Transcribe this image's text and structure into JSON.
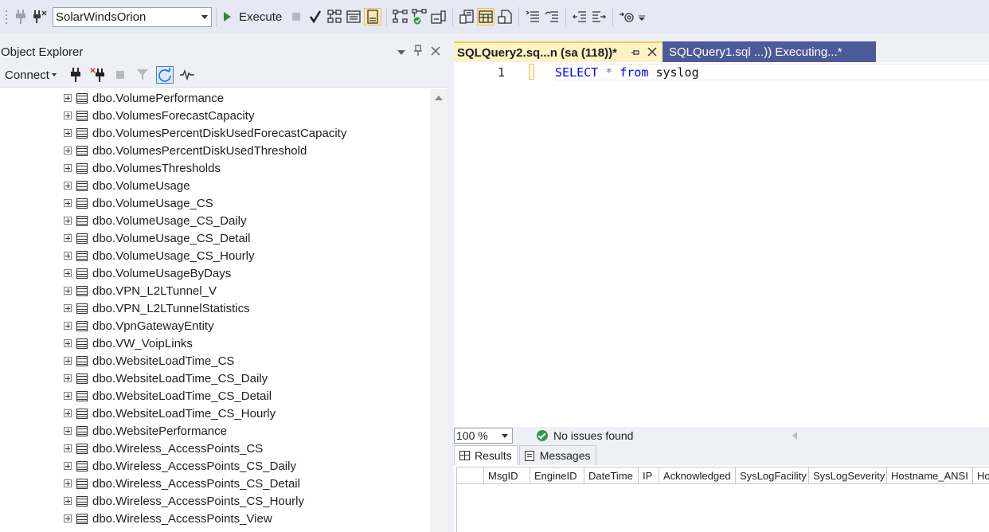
{
  "toolbar": {
    "database": "SolarWindsOrion",
    "execute_label": "Execute"
  },
  "object_explorer": {
    "title": "Object Explorer",
    "connect_label": "Connect",
    "items": [
      "dbo.VolumePerformance",
      "dbo.VolumesForecastCapacity",
      "dbo.VolumesPercentDiskUsedForecastCapacity",
      "dbo.VolumesPercentDiskUsedThreshold",
      "dbo.VolumesThresholds",
      "dbo.VolumeUsage",
      "dbo.VolumeUsage_CS",
      "dbo.VolumeUsage_CS_Daily",
      "dbo.VolumeUsage_CS_Detail",
      "dbo.VolumeUsage_CS_Hourly",
      "dbo.VolumeUsageByDays",
      "dbo.VPN_L2LTunnel_V",
      "dbo.VPN_L2LTunnelStatistics",
      "dbo.VpnGatewayEntity",
      "dbo.VW_VoipLinks",
      "dbo.WebsiteLoadTime_CS",
      "dbo.WebsiteLoadTime_CS_Daily",
      "dbo.WebsiteLoadTime_CS_Detail",
      "dbo.WebsiteLoadTime_CS_Hourly",
      "dbo.WebsitePerformance",
      "dbo.Wireless_AccessPoints_CS",
      "dbo.Wireless_AccessPoints_CS_Daily",
      "dbo.Wireless_AccessPoints_CS_Detail",
      "dbo.Wireless_AccessPoints_CS_Hourly",
      "dbo.Wireless_AccessPoints_View"
    ]
  },
  "tabs": {
    "active": "SQLQuery2.sq...n (sa (118))*",
    "inactive": "SQLQuery1.sql ...)) Executing...*"
  },
  "editor": {
    "line_number": "1",
    "kw_select": "SELECT",
    "op_star": "*",
    "kw_from": "from",
    "table": "syslog"
  },
  "status": {
    "zoom": "100 %",
    "issues": "No issues found"
  },
  "results": {
    "tab_results": "Results",
    "tab_messages": "Messages",
    "columns": [
      "MsgID",
      "EngineID",
      "DateTime",
      "IP",
      "Acknowledged",
      "SysLogFacility",
      "SysLogSeverity",
      "Hostname_ANSI",
      "Ho"
    ]
  },
  "colors": {
    "accent_tab": "#fff3c6",
    "inactive_tab": "#4d5a99",
    "keyword": "#0000ff",
    "success": "#2e9a48"
  }
}
